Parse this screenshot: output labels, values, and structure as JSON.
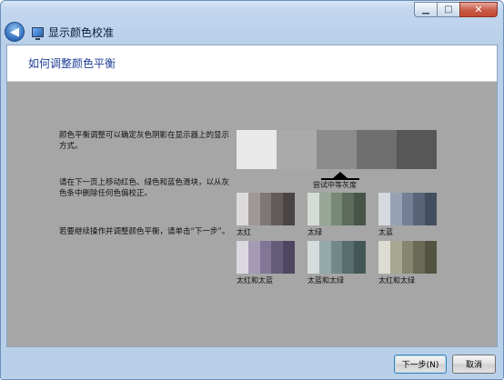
{
  "window": {
    "title": "显示颜色校准",
    "caption": {
      "minimize": "▁",
      "maximize": "□",
      "close": "✕"
    },
    "back_glyph": "◀"
  },
  "header": {
    "title": "如何调整颜色平衡"
  },
  "instructions": {
    "p1": "颜色平衡调整可以确定灰色阴影在显示器上的显示方式。",
    "p2": "请在下一页上移动红色、绿色和蓝色滑块，以从灰色条中删除任何色偏校正。",
    "p3": "若要继续操作并调整颜色平衡，请单击“下一步”。"
  },
  "gray_strip": {
    "colors": [
      "#e9e9e9",
      "#aaaaaa",
      "#8c8c8c",
      "#6f6f6f",
      "#575757"
    ],
    "marker_label": "尝试中等灰度"
  },
  "swatches": [
    {
      "label": "太红",
      "colors": [
        "#dcdada",
        "#a09896",
        "#7e7775",
        "#625b5a",
        "#4b4444"
      ]
    },
    {
      "label": "太绿",
      "colors": [
        "#d5dbd5",
        "#97a697",
        "#778877",
        "#5c6b5c",
        "#475447"
      ]
    },
    {
      "label": "太蓝",
      "colors": [
        "#d6dae0",
        "#96a2b4",
        "#738095",
        "#586579",
        "#434e60"
      ]
    },
    {
      "label": "太红和太蓝",
      "colors": [
        "#dcd8e0",
        "#a49ab4",
        "#817696",
        "#655c79",
        "#4e4560"
      ]
    },
    {
      "label": "太蓝和太绿",
      "colors": [
        "#d4dcdc",
        "#94a9a9",
        "#738989",
        "#586e6e",
        "#435757"
      ]
    },
    {
      "label": "太红和太绿",
      "colors": [
        "#dcdcd2",
        "#a8a892",
        "#868670",
        "#6a6a56",
        "#535341"
      ]
    }
  ],
  "buttons": {
    "next": "下一步(N)",
    "cancel": "取消"
  }
}
